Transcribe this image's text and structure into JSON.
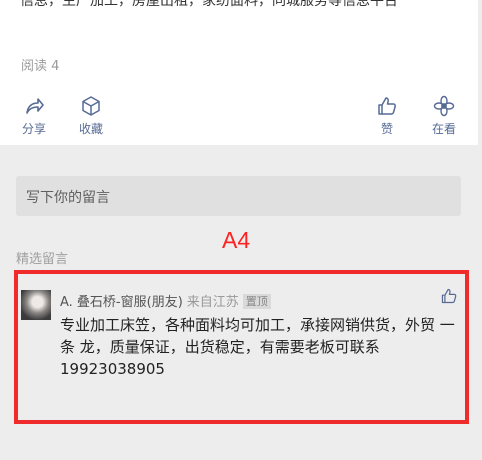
{
  "article": {
    "tail_text": "信息，生产加工，房屋出租，家纺面料，同城服务等信息平台",
    "read_count": "阅读 4"
  },
  "actions": [
    {
      "label": "分享",
      "icon": "share-icon"
    },
    {
      "label": "收藏",
      "icon": "favorite-cube-icon"
    },
    {
      "label": "赞",
      "icon": "thumbs-up-icon"
    },
    {
      "label": "在看",
      "icon": "wow-flower-icon"
    }
  ],
  "comment_input": {
    "placeholder": "写下你的留言"
  },
  "featured_comments": {
    "label": "精选留言",
    "annotation": "A4",
    "items": [
      {
        "nickname": "A. 叠石桥-窗服(朋友)",
        "origin": "来自江苏",
        "pinned_badge": "置顶",
        "text": "专业加工床笠，各种面料均可加工，承接网销供货，外贸 一条 龙，质量保证，出货稳定，有需要老板可联系19923038905"
      }
    ]
  },
  "colors": {
    "link_blue": "#576b95",
    "highlight_red": "#ef2b2b",
    "background": "#ededed"
  }
}
